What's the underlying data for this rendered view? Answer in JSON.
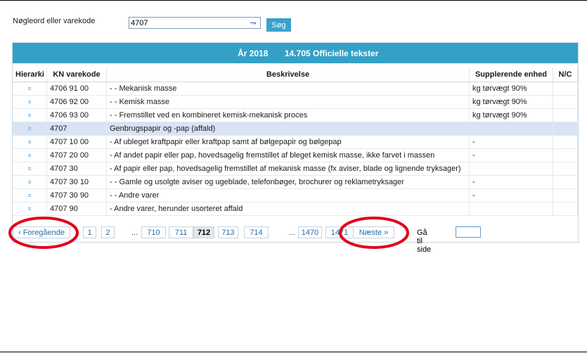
{
  "search": {
    "label": "Nøgleord eller varekode",
    "value": "4707",
    "button_label": "Søg",
    "history_icon": "dropdown-history-icon"
  },
  "panel": {
    "year": "År 2018",
    "count": "14.705 Officielle tekster"
  },
  "table": {
    "headers": [
      "Hierarki",
      "KN varekode",
      "Beskrivelse",
      "Supplerende enhed",
      "N/C"
    ],
    "rows": [
      {
        "code": "4706 91 00",
        "description": "- - Mekanisk masse",
        "unit": "kg tørvægt 90%",
        "selected": false
      },
      {
        "code": "4706 92 00",
        "description": "- - Kemisk masse",
        "unit": "kg tørvægt 90%",
        "selected": false
      },
      {
        "code": "4706 93 00",
        "description": "- - Fremstillet ved en kombineret kemisk-mekanisk proces",
        "unit": "kg tørvægt 90%",
        "selected": false
      },
      {
        "code": "4707",
        "description": "Genbrugspapir og -pap (affald)",
        "unit": "",
        "selected": true
      },
      {
        "code": "4707 10 00",
        "description": "- Af ubleget kraftpapir eller kraftpap samt af bølgepapir og bølgepap",
        "unit": "-",
        "selected": false
      },
      {
        "code": "4707 20 00",
        "description": "- Af andet papir eller pap, hovedsagelig fremstillet af bleget kemisk masse, ikke farvet i massen",
        "unit": "-",
        "selected": false
      },
      {
        "code": "4707 30",
        "description": "- Af papir eller pap, hovedsagelig fremstillet af mekanisk masse (fx aviser, blade og lignende tryksager)",
        "unit": "",
        "selected": false
      },
      {
        "code": "4707 30 10",
        "description": "- - Gamle og usolgte aviser og ugeblade, telefonbøger, brochurer og reklametryksager",
        "unit": "-",
        "selected": false
      },
      {
        "code": "4707 30 90",
        "description": "- - Andre varer",
        "unit": "-",
        "selected": false
      },
      {
        "code": "4707 90",
        "description": "- Andre varer, herunder usorteret affald",
        "unit": "",
        "selected": false
      }
    ]
  },
  "pager": {
    "prev_label": "‹ Foregående",
    "pages_start": [
      "1",
      "2"
    ],
    "ellipsis": "...",
    "pages_mid": [
      "710",
      "711",
      "712",
      "713",
      "714"
    ],
    "current_page": "712",
    "pages_end": [
      "1470",
      "1471"
    ],
    "next_label": "Næste »",
    "goto_label": "Gå til side",
    "goto_value": ""
  },
  "annotation_color": "#e2001a"
}
